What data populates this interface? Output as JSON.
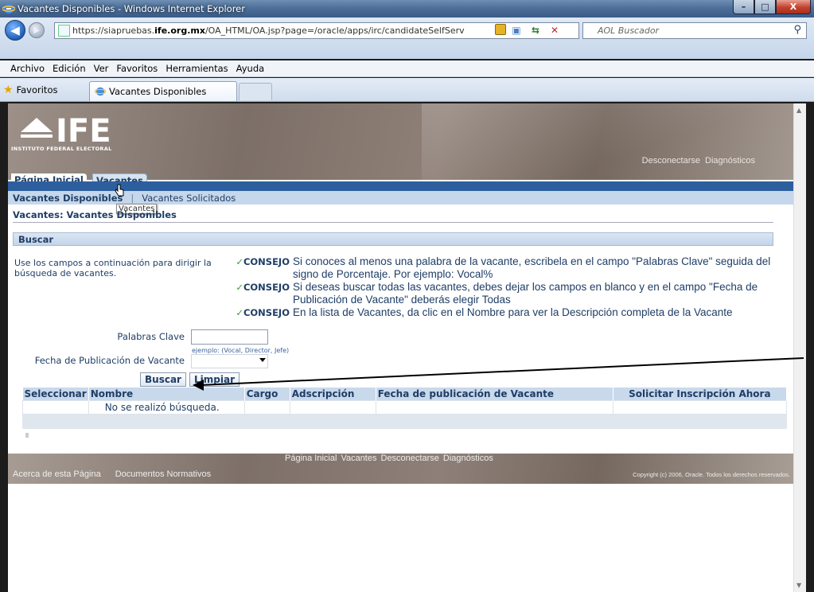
{
  "window": {
    "title": "Vacantes Disponibles - Windows Internet Explorer",
    "min": "–",
    "max": "□",
    "close": "X"
  },
  "address": {
    "url_prefix": "https://siapruebas.",
    "url_domain": "ife.org.mx",
    "url_rest": "/OA_HTML/OA.jsp?page=/oracle/apps/irc/candidateSelfServ",
    "search_placeholder": "AOL Buscador"
  },
  "menu": [
    "Archivo",
    "Edición",
    "Ver",
    "Favoritos",
    "Herramientas",
    "Ayuda"
  ],
  "favorites_label": "Favoritos",
  "browser_tab": "Vacantes Disponibles",
  "site": {
    "logo_text": "IFE",
    "logo_subtitle": "INSTITUTO FEDERAL ELECTORAL",
    "top_links": [
      "Desconectarse",
      "Diagnósticos"
    ]
  },
  "tabs": {
    "home": "Página Inicial",
    "vacancies": "Vacantes"
  },
  "subnav": {
    "current": "Vacantes Disponibles",
    "separator": "|",
    "other": "Vacantes Solicitados"
  },
  "tooltip": "Vacantes",
  "breadcrumb": "Vacantes: Vacantes Disponibles",
  "section": "Buscar",
  "instructions": "Use los campos a continuación para dirigir la búsqueda de vacantes.",
  "tips": [
    {
      "label": "CONSEJO",
      "text": "Si conoces al menos una palabra de la vacante, escribela en el campo \"Palabras Clave\" seguida del signo de Porcentaje. Por ejemplo: Vocal%"
    },
    {
      "label": "CONSEJO",
      "text": "Si deseas buscar todas las vacantes, debes dejar los campos en blanco y en el campo \"Fecha de Publicación de Vacante\" deberás elegir Todas"
    },
    {
      "label": "CONSEJO",
      "text": "En la lista de Vacantes, da clic en el Nombre para ver la Descripción completa de la Vacante"
    }
  ],
  "form": {
    "keywords_label": "Palabras Clave",
    "keywords_value": "",
    "keywords_hint": "ejemplo: (Vocal, Director, Jefe)",
    "date_label": "Fecha de Publicación de Vacante",
    "date_value": "",
    "search_button": "Buscar",
    "clear_button": "Limpiar"
  },
  "table": {
    "headers": [
      "Seleccionar",
      "Nombre",
      "Cargo",
      "Adscripción",
      "Fecha de publicación de Vacante",
      "Solicitar Inscripción Ahora"
    ],
    "empty_message": "No se realizó búsqueda."
  },
  "footer": {
    "links": [
      "Página Inicial",
      "Vacantes",
      "Desconectarse",
      "Diagnósticos"
    ],
    "left_links": [
      "Acerca de esta Página",
      "Documentos Normativos"
    ],
    "copyright": "Copyright (c) 2006, Oracle. Todos los derechos reservados."
  },
  "colors": {
    "accent": "#2d5f9f",
    "link": "#1f3e66",
    "banner": "#7c6f67"
  }
}
